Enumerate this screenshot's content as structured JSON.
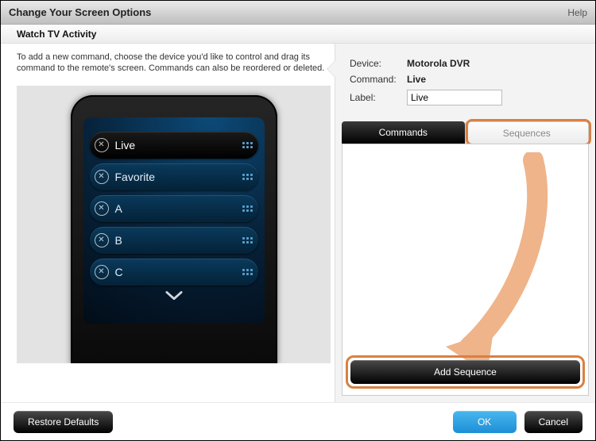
{
  "titlebar": {
    "title": "Change Your Screen Options",
    "help": "Help"
  },
  "subbar": {
    "activity": "Watch TV Activity"
  },
  "instructions": "To add a new command, choose the device you'd like to control and drag its command to the remote's screen. Commands can also be reordered or deleted.",
  "remote": {
    "items": [
      "Live",
      "Favorite",
      "A",
      "B",
      "C"
    ],
    "selected_index": 0
  },
  "props": {
    "device_label": "Device:",
    "device_value": "Motorola DVR",
    "command_label": "Command:",
    "command_value": "Live",
    "label_label": "Label:",
    "label_value": "Live"
  },
  "tabs": {
    "commands": "Commands",
    "sequences": "Sequences"
  },
  "buttons": {
    "add_sequence": "Add Sequence",
    "restore": "Restore Defaults",
    "ok": "OK",
    "cancel": "Cancel"
  }
}
